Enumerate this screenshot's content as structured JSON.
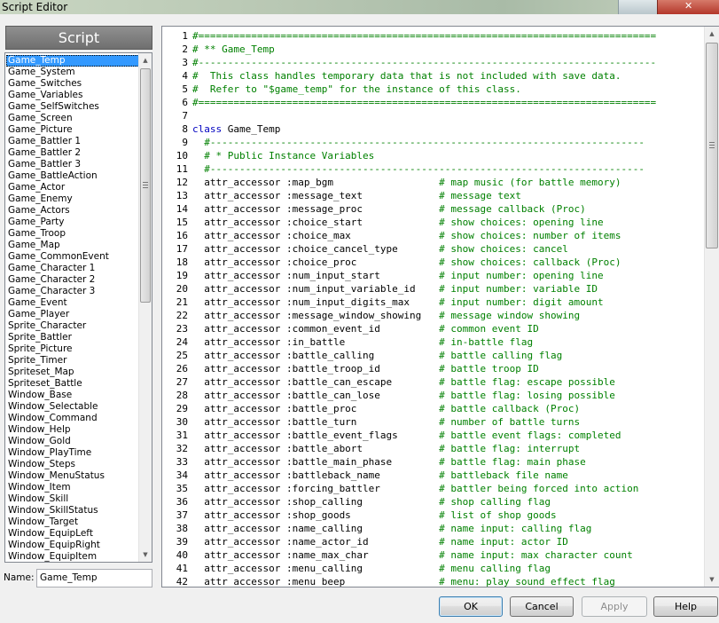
{
  "window": {
    "title": "Script Editor"
  },
  "sidebar": {
    "header": "Script",
    "selected_index": 0,
    "items": [
      "Game_Temp",
      "Game_System",
      "Game_Switches",
      "Game_Variables",
      "Game_SelfSwitches",
      "Game_Screen",
      "Game_Picture",
      "Game_Battler 1",
      "Game_Battler 2",
      "Game_Battler 3",
      "Game_BattleAction",
      "Game_Actor",
      "Game_Enemy",
      "Game_Actors",
      "Game_Party",
      "Game_Troop",
      "Game_Map",
      "Game_CommonEvent",
      "Game_Character 1",
      "Game_Character 2",
      "Game_Character 3",
      "Game_Event",
      "Game_Player",
      "Sprite_Character",
      "Sprite_Battler",
      "Sprite_Picture",
      "Sprite_Timer",
      "Spriteset_Map",
      "Spriteset_Battle",
      "Window_Base",
      "Window_Selectable",
      "Window_Command",
      "Window_Help",
      "Window_Gold",
      "Window_PlayTime",
      "Window_Steps",
      "Window_MenuStatus",
      "Window_Item",
      "Window_Skill",
      "Window_SkillStatus",
      "Window_Target",
      "Window_EquipLeft",
      "Window_EquipRight",
      "Window_EquipItem"
    ]
  },
  "name_field": {
    "label": "Name:",
    "value": "Game_Temp"
  },
  "editor": {
    "lines": [
      {
        "n": "1",
        "code": "#==============================================================================",
        "comment": ""
      },
      {
        "n": "2",
        "code": "# ** Game_Temp",
        "comment": ""
      },
      {
        "n": "3",
        "code": "#------------------------------------------------------------------------------",
        "comment": ""
      },
      {
        "n": "4",
        "code": "#  This class handles temporary data that is not included with save data.",
        "comment": ""
      },
      {
        "n": "5",
        "code": "#  Refer to \"$game_temp\" for the instance of this class.",
        "comment": ""
      },
      {
        "n": "6",
        "code": "#==============================================================================",
        "comment": ""
      },
      {
        "n": "7",
        "code": "",
        "comment": ""
      },
      {
        "n": "8",
        "code": "class Game_Temp",
        "comment": ""
      },
      {
        "n": "9",
        "code": "  #--------------------------------------------------------------------------",
        "comment": ""
      },
      {
        "n": "10",
        "code": "  # * Public Instance Variables",
        "comment": ""
      },
      {
        "n": "11",
        "code": "  #--------------------------------------------------------------------------",
        "comment": ""
      },
      {
        "n": "12",
        "code": "  attr_accessor :map_bgm                  ",
        "comment": "# map music (for battle memory)"
      },
      {
        "n": "13",
        "code": "  attr_accessor :message_text             ",
        "comment": "# message text"
      },
      {
        "n": "14",
        "code": "  attr_accessor :message_proc             ",
        "comment": "# message callback (Proc)"
      },
      {
        "n": "15",
        "code": "  attr_accessor :choice_start             ",
        "comment": "# show choices: opening line"
      },
      {
        "n": "16",
        "code": "  attr_accessor :choice_max               ",
        "comment": "# show choices: number of items"
      },
      {
        "n": "17",
        "code": "  attr_accessor :choice_cancel_type       ",
        "comment": "# show choices: cancel"
      },
      {
        "n": "18",
        "code": "  attr_accessor :choice_proc              ",
        "comment": "# show choices: callback (Proc)"
      },
      {
        "n": "19",
        "code": "  attr_accessor :num_input_start          ",
        "comment": "# input number: opening line"
      },
      {
        "n": "20",
        "code": "  attr_accessor :num_input_variable_id    ",
        "comment": "# input number: variable ID"
      },
      {
        "n": "21",
        "code": "  attr_accessor :num_input_digits_max     ",
        "comment": "# input number: digit amount"
      },
      {
        "n": "22",
        "code": "  attr_accessor :message_window_showing   ",
        "comment": "# message window showing"
      },
      {
        "n": "23",
        "code": "  attr_accessor :common_event_id          ",
        "comment": "# common event ID"
      },
      {
        "n": "24",
        "code": "  attr_accessor :in_battle                ",
        "comment": "# in-battle flag"
      },
      {
        "n": "25",
        "code": "  attr_accessor :battle_calling           ",
        "comment": "# battle calling flag"
      },
      {
        "n": "26",
        "code": "  attr_accessor :battle_troop_id          ",
        "comment": "# battle troop ID"
      },
      {
        "n": "27",
        "code": "  attr_accessor :battle_can_escape        ",
        "comment": "# battle flag: escape possible"
      },
      {
        "n": "28",
        "code": "  attr_accessor :battle_can_lose          ",
        "comment": "# battle flag: losing possible"
      },
      {
        "n": "29",
        "code": "  attr_accessor :battle_proc              ",
        "comment": "# battle callback (Proc)"
      },
      {
        "n": "30",
        "code": "  attr_accessor :battle_turn              ",
        "comment": "# number of battle turns"
      },
      {
        "n": "31",
        "code": "  attr_accessor :battle_event_flags       ",
        "comment": "# battle event flags: completed"
      },
      {
        "n": "32",
        "code": "  attr_accessor :battle_abort             ",
        "comment": "# battle flag: interrupt"
      },
      {
        "n": "33",
        "code": "  attr_accessor :battle_main_phase        ",
        "comment": "# battle flag: main phase"
      },
      {
        "n": "34",
        "code": "  attr_accessor :battleback_name          ",
        "comment": "# battleback file name"
      },
      {
        "n": "35",
        "code": "  attr_accessor :forcing_battler          ",
        "comment": "# battler being forced into action"
      },
      {
        "n": "36",
        "code": "  attr_accessor :shop_calling             ",
        "comment": "# shop calling flag"
      },
      {
        "n": "37",
        "code": "  attr_accessor :shop_goods               ",
        "comment": "# list of shop goods"
      },
      {
        "n": "38",
        "code": "  attr_accessor :name_calling             ",
        "comment": "# name input: calling flag"
      },
      {
        "n": "39",
        "code": "  attr_accessor :name_actor_id            ",
        "comment": "# name input: actor ID"
      },
      {
        "n": "40",
        "code": "  attr_accessor :name_max_char            ",
        "comment": "# name input: max character count"
      },
      {
        "n": "41",
        "code": "  attr_accessor :menu_calling             ",
        "comment": "# menu calling flag"
      },
      {
        "n": "42",
        "code": "  attr_accessor :menu_beep                ",
        "comment": "# menu: play sound effect flag"
      }
    ]
  },
  "buttons": {
    "ok": "OK",
    "cancel": "Cancel",
    "apply": "Apply",
    "help": "Help"
  },
  "icons": {
    "close": "close-icon",
    "scroll_up": "scroll-up-arrow-icon",
    "scroll_down": "scroll-down-arrow-icon"
  },
  "colors": {
    "selection": "#3399ff",
    "comment": "#008000",
    "keyword": "#0000c0",
    "header": "#7f7f7f"
  }
}
